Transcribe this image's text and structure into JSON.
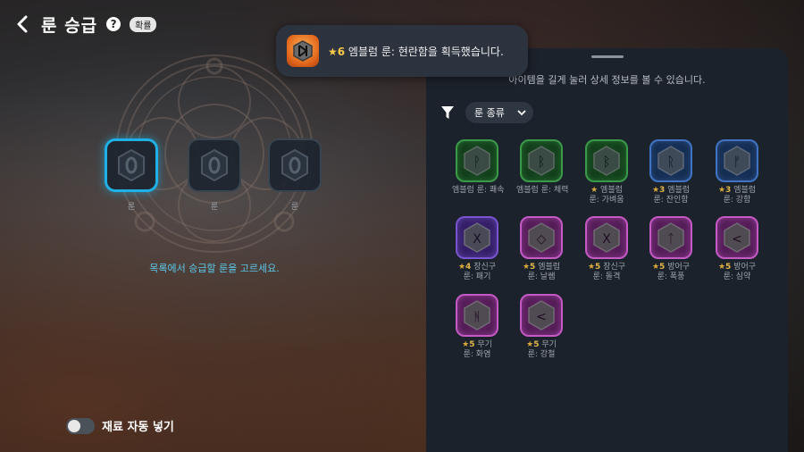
{
  "header": {
    "title": "룬 승급",
    "help_glyph": "?",
    "prob_badge": "확률"
  },
  "toast": {
    "star_text": "★6",
    "message": " 엠블럼 룬: 현란함을 획득했습니다.",
    "icon": "rune-emblem-icon"
  },
  "upgrade": {
    "slots": [
      {
        "label": "룬"
      },
      {
        "label": "룬"
      },
      {
        "label": "룬"
      }
    ],
    "instruction": "목록에서 승급할 룬을 고르세요."
  },
  "auto_fill": {
    "label": "재료 자동 넣기",
    "enabled": false
  },
  "panel": {
    "hint": "아이템을 길게 눌러 상세 정보를 볼 수 있습니다.",
    "filter_dropdown": "룬 종류",
    "runes": [
      {
        "grade": "",
        "line1": "엠블럼 룬: 쾌속",
        "line2": "",
        "color": "#3b9a49",
        "glyph": "ᚹ"
      },
      {
        "grade": "",
        "line1": "엠블럼 룬: 체력",
        "line2": "",
        "color": "#3b9a49",
        "glyph": "ᛒ"
      },
      {
        "grade": "",
        "line1": "엠블럼",
        "line2": "룬: 가벼움",
        "color": "#3b9a49",
        "glyph": "ᛒ"
      },
      {
        "grade": "3",
        "line1": "엠블럼",
        "line2": "룬: 잔인함",
        "color": "#3f73c4",
        "glyph": "ᚱ"
      },
      {
        "grade": "3",
        "line1": "엠블럼",
        "line2": "룬: 강함",
        "color": "#3f73c4",
        "glyph": "ᚠ"
      },
      {
        "grade": "4",
        "line1": "장신구",
        "line2": "룬: 패기",
        "color": "#7a54d0",
        "glyph": "X"
      },
      {
        "grade": "5",
        "line1": "엠블럼",
        "line2": "룬: 날쌤",
        "color": "#c45ac4",
        "glyph": "◇"
      },
      {
        "grade": "5",
        "line1": "장신구",
        "line2": "룬: 돌격",
        "color": "#c45ac4",
        "glyph": "X"
      },
      {
        "grade": "5",
        "line1": "방어구",
        "line2": "룬: 폭풍",
        "color": "#c45ac4",
        "glyph": "ᛏ"
      },
      {
        "grade": "5",
        "line1": "방어구",
        "line2": "룬: 심약",
        "color": "#c45ac4",
        "glyph": "<"
      },
      {
        "grade": "5",
        "line1": "무기",
        "line2": "룬: 화염",
        "color": "#c45ac4",
        "glyph": "ᚻ"
      },
      {
        "grade": "5",
        "line1": "무기",
        "line2": "룬: 강철",
        "color": "#c45ac4",
        "glyph": "<"
      }
    ]
  }
}
